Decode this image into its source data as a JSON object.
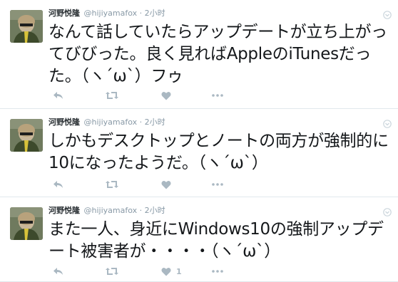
{
  "tweets": [
    {
      "name": "河野悦隆",
      "handle": "@hijiyamafox",
      "separator": "·",
      "time": "2小时",
      "text": "なんて話していたらアップデートが立ち上がってびびった。良く見ればAppleのiTunesだった。（ヽ´ω`）フゥ",
      "like_count": ""
    },
    {
      "name": "河野悦隆",
      "handle": "@hijiyamafox",
      "separator": "·",
      "time": "2小时",
      "text": "しかもデスクトップとノートの両方が強制的に10になったようだ。（ヽ´ω`）",
      "like_count": ""
    },
    {
      "name": "河野悦隆",
      "handle": "@hijiyamafox",
      "separator": "·",
      "time": "2小时",
      "text": "また一人、身近にWindows10の強制アップデート被害者が・・・・（ヽ´ω`）",
      "like_count": "1"
    }
  ],
  "icons": {
    "reply": "reply-icon",
    "retweet": "retweet-icon",
    "like": "heart-icon",
    "more": "more-dots-icon",
    "caret": "chevron-down-icon"
  },
  "colors": {
    "action_gray": "#aab8c2",
    "meta_gray": "#8899a6",
    "divider": "#e1e8ed"
  }
}
